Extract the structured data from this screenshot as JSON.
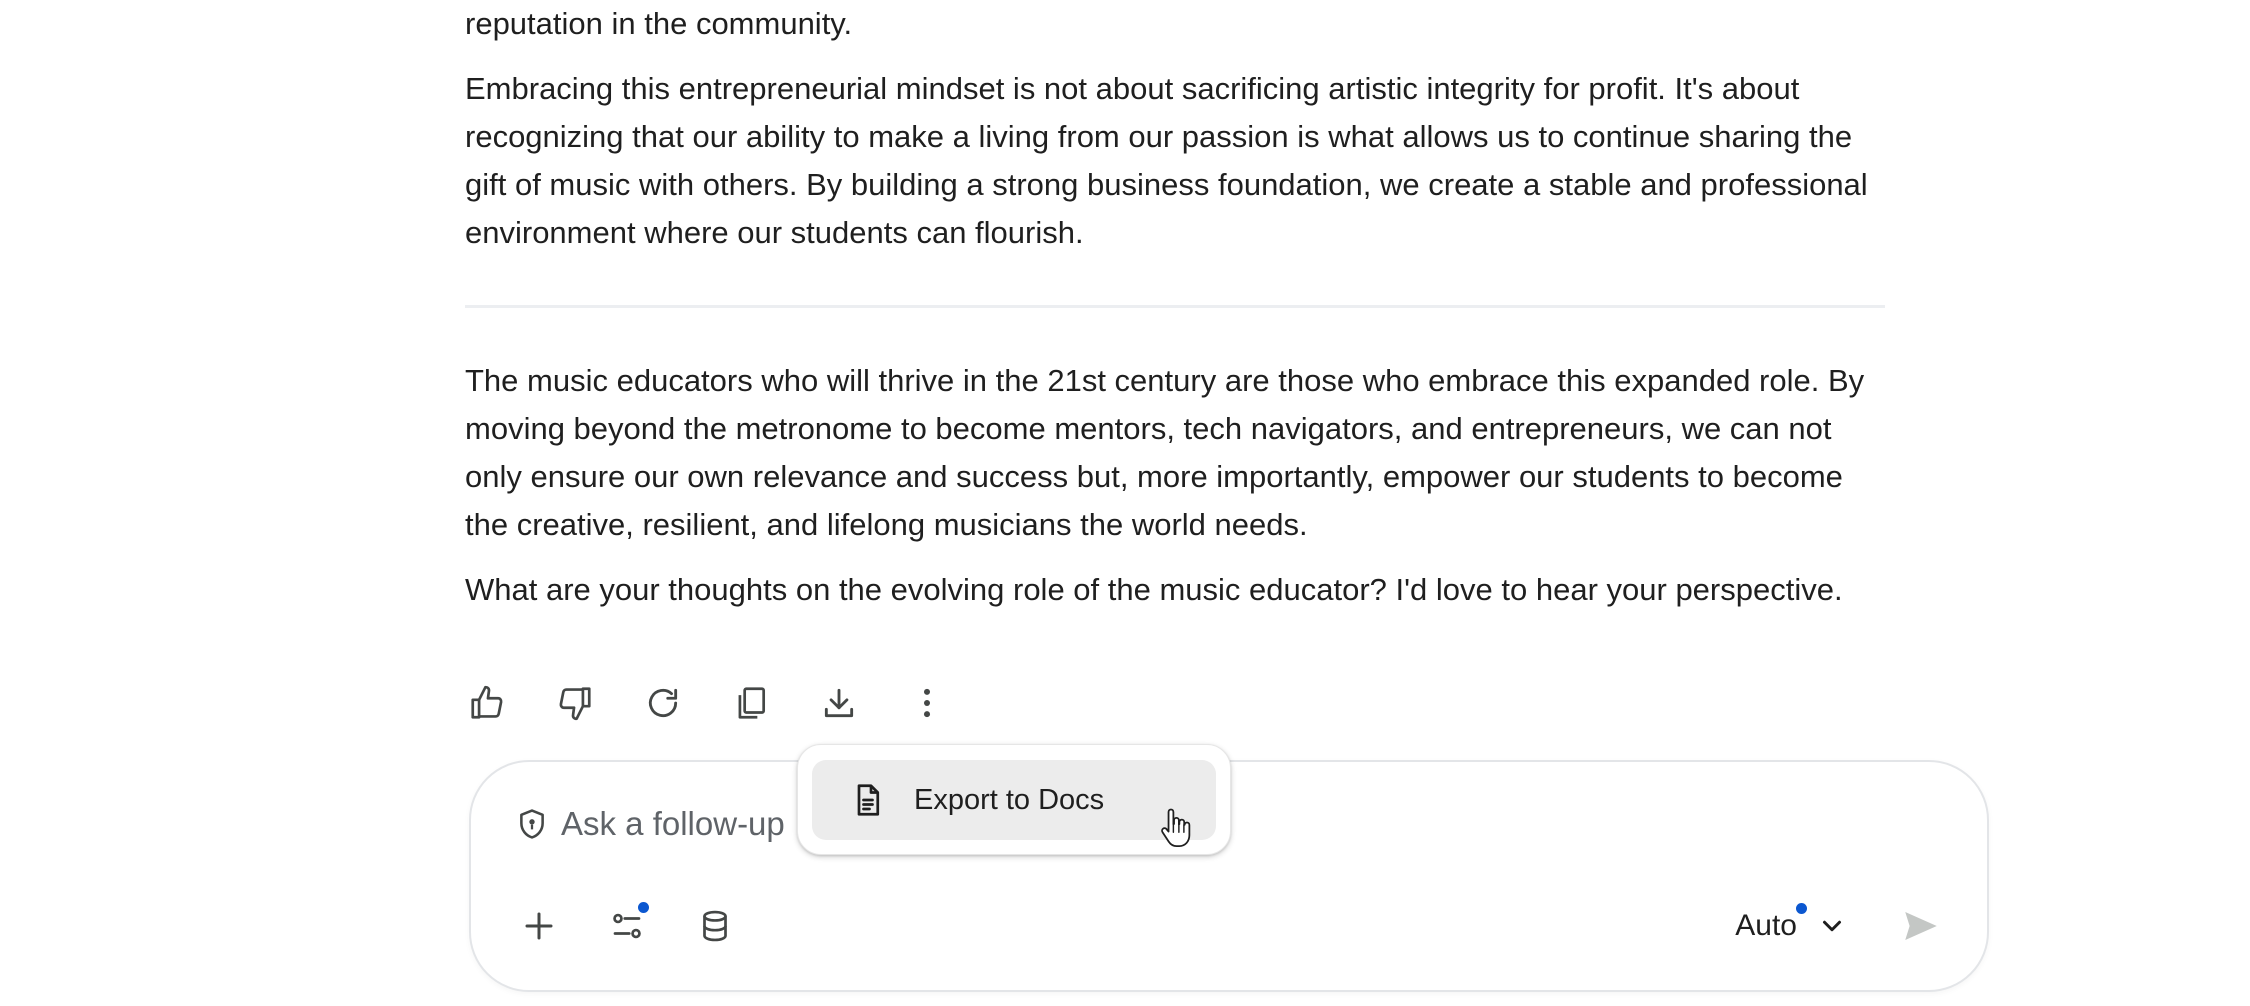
{
  "response": {
    "paragraphs": [
      "reputation in the community.",
      "Embracing this entrepreneurial mindset is not about sacrificing artistic integrity for profit. It's about recognizing that our ability to make a living from our passion is what allows us to continue sharing the gift of music with others. By building a strong business foundation, we create a stable and professional environment where our students can flourish.",
      "The music educators who will thrive in the 21st century are those who embrace this expanded role. By moving beyond the metronome to become mentors, tech navigators, and entrepreneurs, we can not only ensure our own relevance and success but, more importantly, empower our students to become the creative, resilient, and lifelong musicians the world needs.",
      "What are your thoughts on the evolving role of the music educator? I'd love to hear your perspective."
    ]
  },
  "actions": {
    "icons": [
      "thumbs-up-icon",
      "thumbs-down-icon",
      "regenerate-icon",
      "copy-icon",
      "download-icon",
      "more-vert-icon"
    ]
  },
  "menu": {
    "items": [
      {
        "label": "Export to Docs",
        "icon": "document-icon"
      }
    ]
  },
  "composer": {
    "placeholder": "Ask a follow-up",
    "model_label": "Auto",
    "accent_color": "#0b57d0"
  }
}
